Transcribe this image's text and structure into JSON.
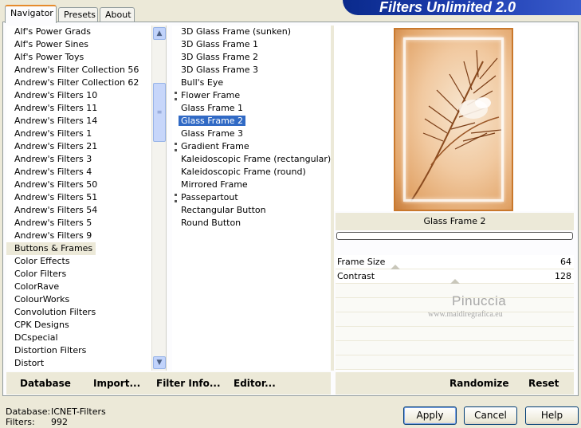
{
  "header": {
    "title": "Filters Unlimited 2.0"
  },
  "tabs": [
    {
      "label": "Navigator",
      "active": true
    },
    {
      "label": "Presets",
      "active": false
    },
    {
      "label": "About",
      "active": false
    }
  ],
  "categories": {
    "items": [
      "Alf's Power Grads",
      "Alf's Power Sines",
      "Alf's Power Toys",
      "Andrew's Filter Collection 56",
      "Andrew's Filter Collection 62",
      "Andrew's Filters 10",
      "Andrew's Filters 11",
      "Andrew's Filters 14",
      "Andrew's Filters 1",
      "Andrew's Filters 21",
      "Andrew's Filters 3",
      "Andrew's Filters 4",
      "Andrew's Filters 50",
      "Andrew's Filters 51",
      "Andrew's Filters 54",
      "Andrew's Filters 5",
      "Andrew's Filters 9",
      "Buttons & Frames",
      "Color Effects",
      "Color Filters",
      "ColorRave",
      "ColourWorks",
      "Convolution Filters",
      "CPK Designs",
      "DCspecial",
      "Distortion Filters",
      "Distort"
    ],
    "selected": "Buttons & Frames"
  },
  "filters": {
    "items": [
      {
        "label": "3D Glass Frame (sunken)",
        "mark": false
      },
      {
        "label": "3D Glass Frame 1",
        "mark": false
      },
      {
        "label": "3D Glass Frame 2",
        "mark": false
      },
      {
        "label": "3D Glass Frame 3",
        "mark": false
      },
      {
        "label": "Bull's Eye",
        "mark": false
      },
      {
        "label": "Flower Frame",
        "mark": true
      },
      {
        "label": "Glass Frame 1",
        "mark": false
      },
      {
        "label": "Glass Frame 2",
        "mark": false
      },
      {
        "label": "Glass Frame 3",
        "mark": false
      },
      {
        "label": "Gradient Frame",
        "mark": true
      },
      {
        "label": "Kaleidoscopic Frame (rectangular)",
        "mark": false
      },
      {
        "label": "Kaleidoscopic Frame (round)",
        "mark": false
      },
      {
        "label": "Mirrored Frame",
        "mark": false
      },
      {
        "label": "Passepartout",
        "mark": true
      },
      {
        "label": "Rectangular Button",
        "mark": false
      },
      {
        "label": "Round Button",
        "mark": false
      }
    ],
    "selected": "Glass Frame 2"
  },
  "preview": {
    "filter_name": "Glass Frame 2"
  },
  "parameters": [
    {
      "label": "Frame Size",
      "value": "64",
      "level": 0.25
    },
    {
      "label": "Contrast",
      "value": "128",
      "level": 0.5
    }
  ],
  "watermark": {
    "name": "Pinuccia",
    "url": "www.maidiregrafica.eu"
  },
  "toolbar_left": {
    "database": "Database",
    "import": "Import...",
    "filter_info": "Filter Info...",
    "editor": "Editor..."
  },
  "toolbar_right": {
    "randomize": "Randomize",
    "reset": "Reset"
  },
  "status": {
    "database_label": "Database:",
    "database_value": "ICNET-Filters",
    "filters_label": "Filters:",
    "filters_value": "992"
  },
  "buttons": {
    "apply": "Apply",
    "cancel": "Cancel",
    "help": "Help"
  }
}
